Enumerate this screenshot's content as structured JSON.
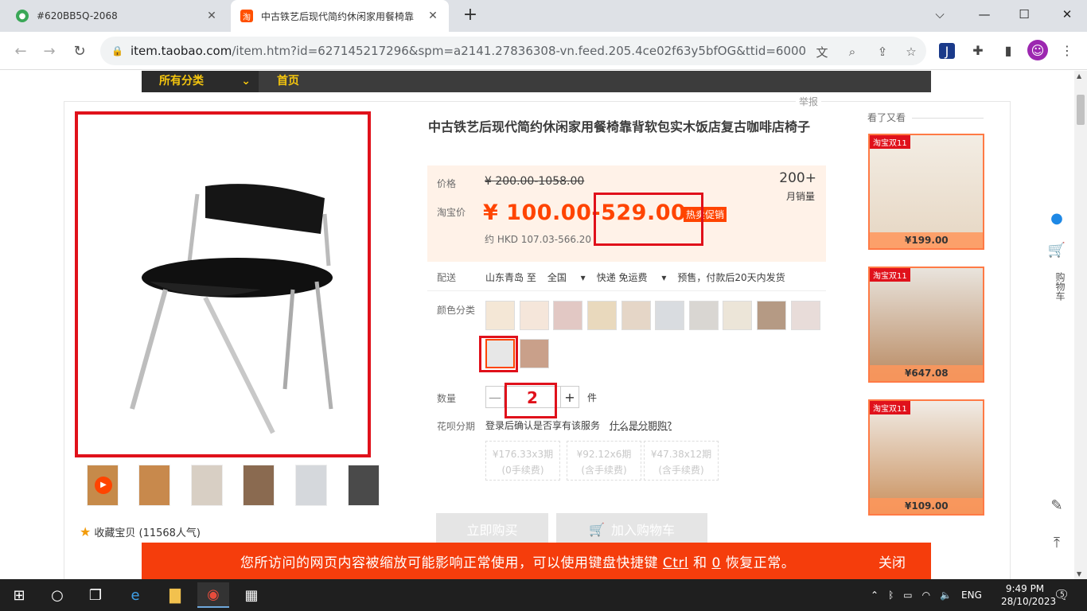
{
  "browser": {
    "tabs": [
      {
        "title": "#620BB5Q-2068",
        "close": "✕"
      },
      {
        "title": "中古铁艺后现代简约休闲家用餐椅靠",
        "close": "✕"
      }
    ],
    "new_tab": "+",
    "url_host": "item.taobao.com",
    "url_path": "/item.htm?id=627145217296&spm=a2141.27836308-vn.feed.205.4ce02f63y5bfOG&ttid=600000...",
    "window_controls": {
      "minimize": "—",
      "maximize": "☐",
      "close": "✕",
      "dropdown": "⌵"
    }
  },
  "nav": {
    "all_categories": "所有分类",
    "home": "首页"
  },
  "product": {
    "report": "举报",
    "title": "中古铁艺后现代简约休闲家用餐椅靠背软包实木饭店复古咖啡店椅子",
    "price_label": "价格",
    "original_price": "¥ 200.00-1058.00",
    "taobao_price_label": "淘宝价",
    "taobao_price": "¥ 100.00-529.00",
    "promo_tag": "热卖促销",
    "hkd": "约 HKD 107.03-566.20",
    "monthly_sales": "200+",
    "monthly_sales_label": "月销量",
    "delivery_label": "配送",
    "delivery_from": "山东青岛 至",
    "delivery_to": "全国",
    "delivery_method": "快递 免运费",
    "delivery_note": "预售，付款后20天内发货",
    "color_label": "颜色分类",
    "quantity_label": "数量",
    "quantity_minus": "—",
    "quantity_value": "2",
    "quantity_plus": "+",
    "quantity_unit": "件",
    "installment_label": "花呗分期",
    "installment_note": "登录后确认是否享有该服务",
    "installment_link": "什么是分期购?",
    "installments": [
      {
        "amount": "¥176.33x3期",
        "fee": "(0手续费)"
      },
      {
        "amount": "¥92.12x6期",
        "fee": "(含手续费)"
      },
      {
        "amount": "¥47.38x12期",
        "fee": "(含手续费)"
      }
    ],
    "buy_now": "立即购买",
    "add_to_cart": "加入购物车",
    "favorite": "收藏宝贝",
    "favorite_count": "(11568人气)"
  },
  "sidebar": {
    "title": "看了又看",
    "items": [
      {
        "badge": "淘宝双11",
        "price": "¥199.00"
      },
      {
        "badge": "淘宝双11",
        "price": "¥647.08"
      },
      {
        "badge": "淘宝双11",
        "price": "¥109.00"
      }
    ],
    "cart_label": "购物车"
  },
  "zoom_banner": {
    "message_pre": "您所访问的网页内容被缩放可能影响正常使用，可以使用键盘快捷键",
    "key1": "Ctrl",
    "and": "和",
    "key2": "0",
    "message_post": "恢复正常。",
    "close": "关闭"
  },
  "taskbar": {
    "lang": "ENG",
    "time": "9:49 PM",
    "date": "28/10/2023",
    "notifications": "5"
  },
  "colors": {
    "accent": "#ff4400",
    "annotation_red": "#e0111b",
    "banner": "#f53d0c",
    "nav_gold": "#f5c60e"
  }
}
